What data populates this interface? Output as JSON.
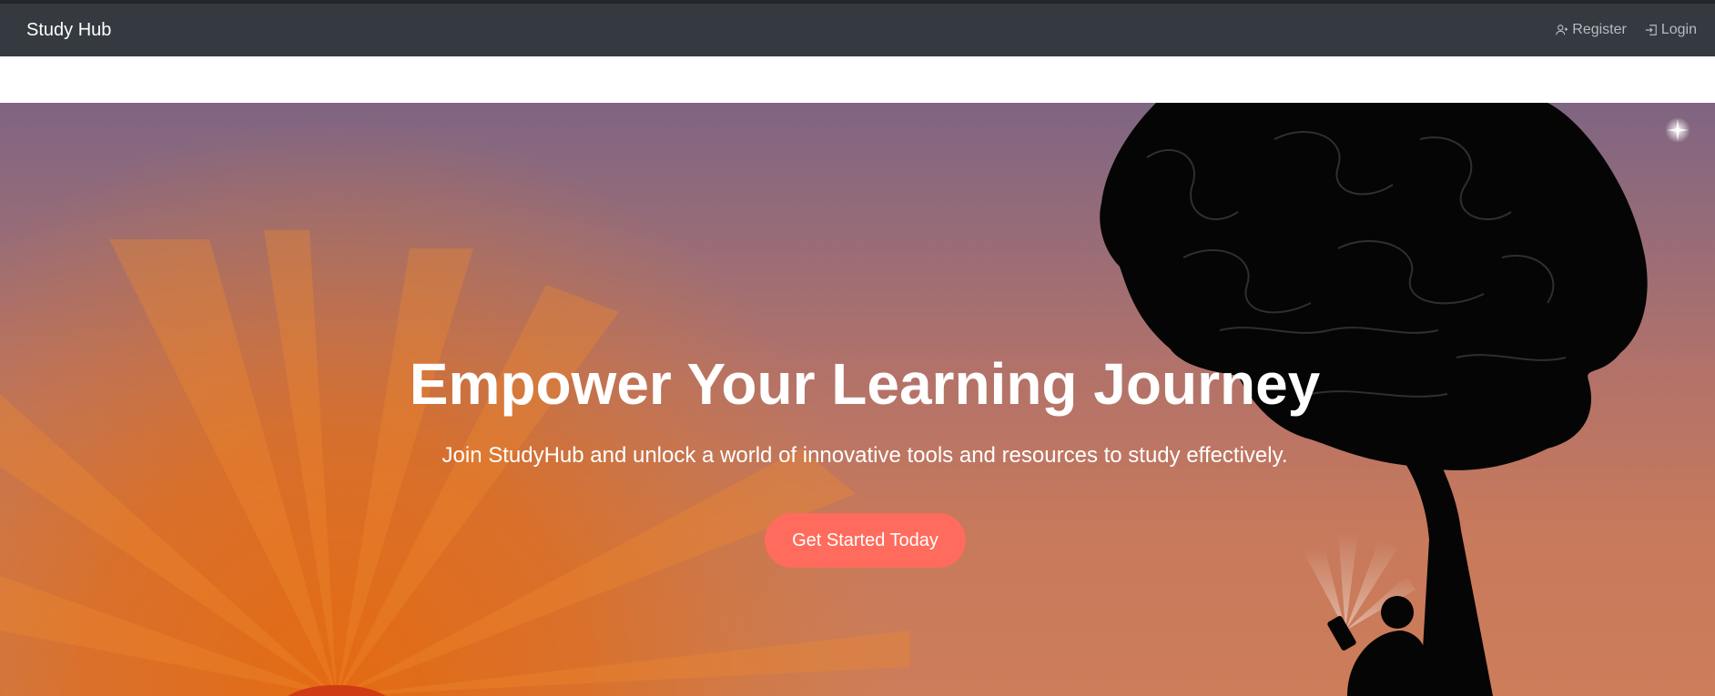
{
  "navbar": {
    "brand": "Study Hub",
    "links": [
      {
        "label": "Register",
        "icon": "user-plus-icon"
      },
      {
        "label": "Login",
        "icon": "login-icon"
      }
    ]
  },
  "hero": {
    "title": "Empower Your Learning Journey",
    "subtitle": "Join StudyHub and unlock a world of innovative tools and resources to study effectively.",
    "cta_label": "Get Started Today"
  },
  "colors": {
    "navbar_bg": "#343a40",
    "nav_link": "#b7bcc1",
    "cta_bg": "#ff6b5c",
    "sky_top": "#7f6582",
    "sky_bottom": "#cd7d59",
    "sun": "#e8690f"
  }
}
